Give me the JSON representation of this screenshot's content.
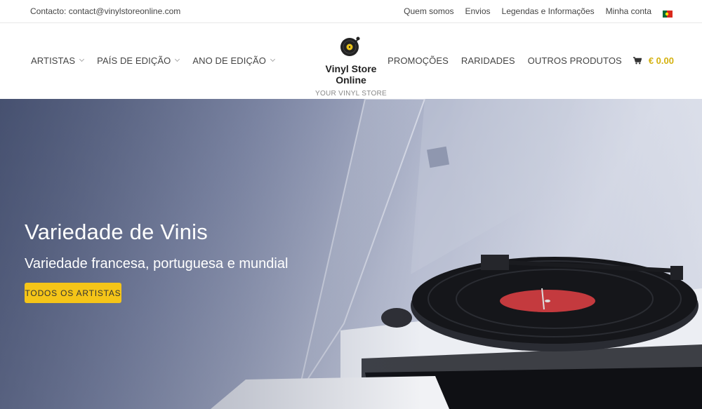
{
  "topbar": {
    "contact": "Contacto: contact@vinylstoreonline.com",
    "links": [
      "Quem somos",
      "Envios",
      "Legendas e Informações",
      "Minha conta"
    ],
    "flag_icon": "portugal-flag-icon"
  },
  "header": {
    "nav_left": [
      "ARTISTAS",
      "PAÍS DE EDIÇÃO",
      "ANO DE EDIÇÃO"
    ],
    "logo": {
      "title": "Vinyl Store Online",
      "tagline": "YOUR VINYL STORE",
      "icon": "record-player-icon"
    },
    "nav_right": [
      "PROMOÇÕES",
      "RARIDADES",
      "OUTROS PRODUTOS"
    ],
    "cart": {
      "icon": "cart-icon",
      "total": "€ 0.00"
    }
  },
  "hero": {
    "title": "Variedade de Vinis",
    "subtitle": "Variedade francesa, portuguesa e mundial",
    "button_label": "TODOS OS ARTISTAS"
  },
  "colors": {
    "accent": "#f5c518",
    "price": "#d4b10e",
    "text": "#444444"
  }
}
